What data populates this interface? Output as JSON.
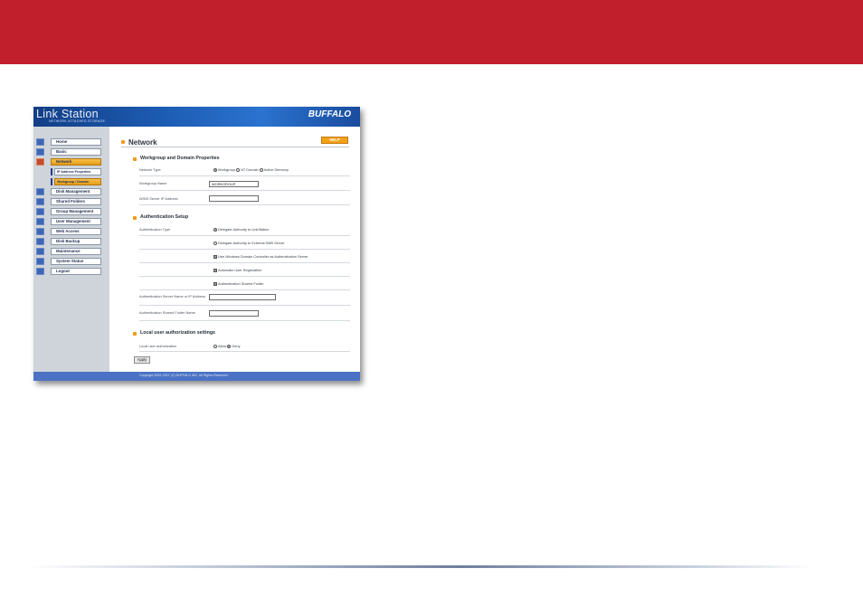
{
  "app": {
    "logo_text": "Link Station",
    "logo_sub": "NETWORK ATTACHED STORAGE",
    "brand": "BUFFALO"
  },
  "sidebar": {
    "items": [
      {
        "label": "Home",
        "icon": "home-icon"
      },
      {
        "label": "Basic",
        "icon": "basic-icon"
      },
      {
        "label": "Network",
        "icon": "network-icon",
        "selected": true
      },
      {
        "label": "IP Address Properties",
        "sub": true
      },
      {
        "label": "Workgroup / Domain",
        "sub": true,
        "selected": true
      },
      {
        "label": "Disk Management",
        "icon": "disk-icon"
      },
      {
        "label": "Shared Folders",
        "icon": "folder-icon"
      },
      {
        "label": "Group Management",
        "icon": "group-icon"
      },
      {
        "label": "User Management",
        "icon": "user-icon"
      },
      {
        "label": "Web Access",
        "icon": "web-icon"
      },
      {
        "label": "Disk Backup",
        "icon": "backup-icon"
      },
      {
        "label": "Maintenance",
        "icon": "maintenance-icon"
      },
      {
        "label": "System Status",
        "icon": "status-icon"
      },
      {
        "label": "Logout",
        "icon": "logout-icon"
      }
    ]
  },
  "main": {
    "title": "Network",
    "help_label": "HELP",
    "workgroup_section": {
      "title": "Workgroup and Domain Properties",
      "network_type_label": "Network Type",
      "network_type_options": [
        "Workgroup",
        "NT Domain",
        "Active Directory"
      ],
      "network_type_selected": "Workgroup",
      "workgroup_name_label": "Workgroup Name",
      "workgroup_name_value": "WORKGROUP",
      "wins_label": "WINS Server IP Address",
      "wins_value": ""
    },
    "auth_section": {
      "title": "Authentication Setup",
      "auth_type_label": "Authentication Type",
      "opt_linkstation": "Delegate Authority to LinkStation",
      "opt_external": "Delegate Authority to External SMB Server",
      "chk_windows_dc": "Use Windows Domain Controller as Authentication Server",
      "chk_auto_reg": "Automatic User Registration",
      "chk_shared_folder": "Authentication Shared Folder",
      "server_label": "Authentication Server Name or IP Address",
      "shared_folder_label": "Authentication Shared Folder Name"
    },
    "local_section": {
      "title": "Local user authorization settings",
      "label": "Local user authorization",
      "allow": "Allow",
      "deny": "Deny",
      "selected": "Deny"
    },
    "apply_label": "Apply"
  },
  "footer": {
    "copyright": "Copyright 2002-2007 (C) BUFFALO INC. All Rights Reserved."
  },
  "colors": {
    "banner": "#c21f2c",
    "header_blue": "#1d5cb3",
    "accent_orange": "#f29a16"
  }
}
